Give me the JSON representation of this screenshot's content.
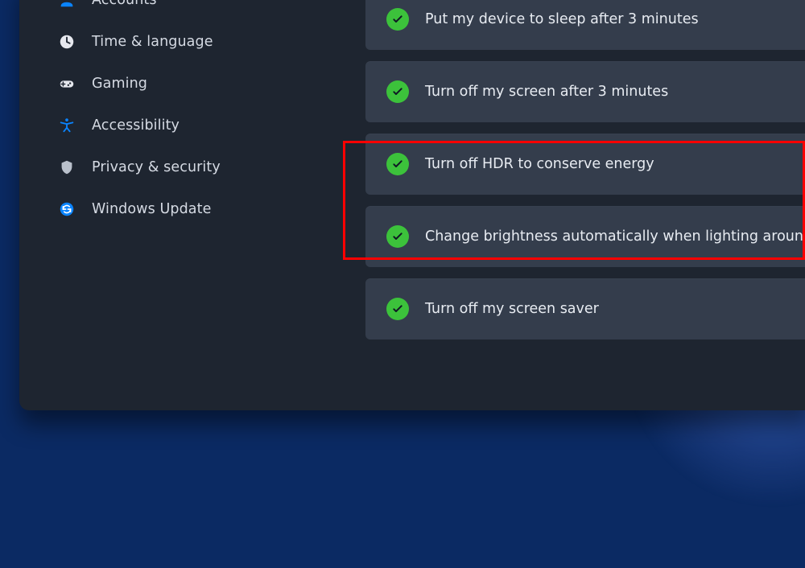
{
  "sidebar": {
    "items": [
      {
        "icon": "accounts-icon",
        "label": "Accounts"
      },
      {
        "icon": "time-language-icon",
        "label": "Time & language"
      },
      {
        "icon": "gaming-icon",
        "label": "Gaming"
      },
      {
        "icon": "accessibility-icon",
        "label": "Accessibility"
      },
      {
        "icon": "privacy-security-icon",
        "label": "Privacy & security"
      },
      {
        "icon": "windows-update-icon",
        "label": "Windows Update"
      }
    ]
  },
  "content": {
    "cards": [
      {
        "status": "done",
        "label": "Put my device to sleep after 3 minutes"
      },
      {
        "status": "done",
        "label": "Turn off my screen after 3 minutes"
      },
      {
        "status": "done",
        "label": "Turn off HDR to conserve energy"
      },
      {
        "status": "done",
        "label": "Change brightness automatically when lighting aroun"
      },
      {
        "status": "done",
        "label": "Turn off my screen saver"
      }
    ]
  },
  "annotation": {
    "highlight_index": 2,
    "color": "#ff0000"
  }
}
